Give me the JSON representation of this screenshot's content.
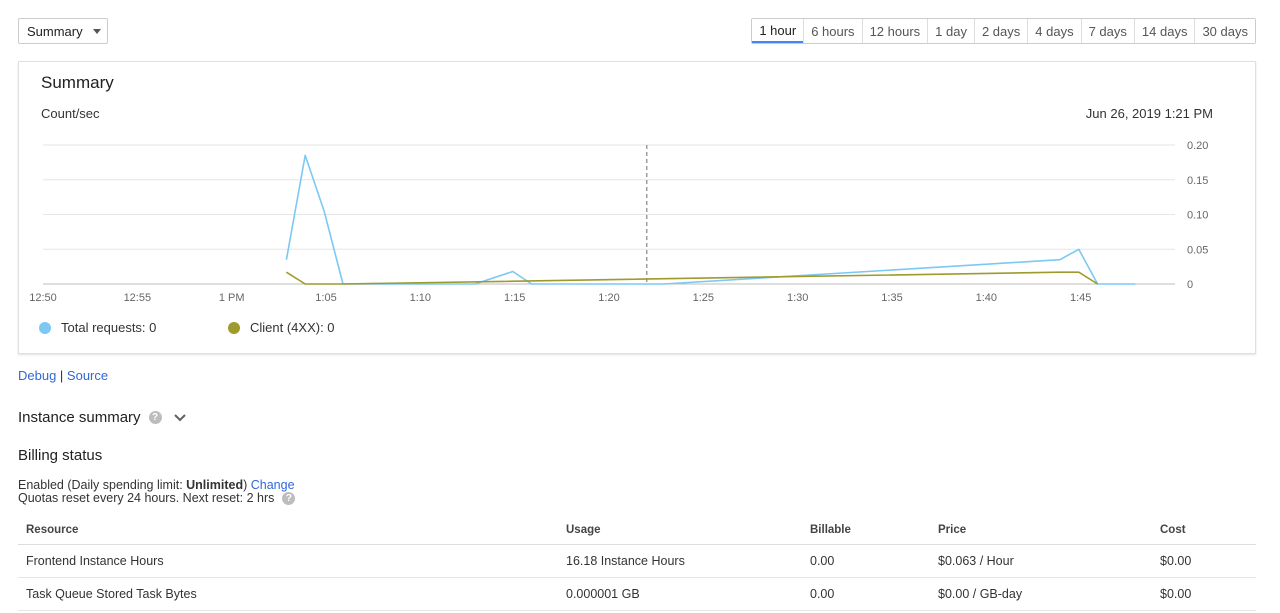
{
  "view_select": {
    "label": "Summary"
  },
  "time_ranges": [
    "1 hour",
    "6 hours",
    "12 hours",
    "1 day",
    "2 days",
    "4 days",
    "7 days",
    "14 days",
    "30 days"
  ],
  "active_range_index": 0,
  "card": {
    "title": "Summary",
    "unit": "Count/sec",
    "timestamp": "Jun 26, 2019 1:21 PM"
  },
  "chart_data": {
    "type": "line",
    "x_tick_labels": [
      "12:50",
      "12:55",
      "1 PM",
      "1:05",
      "1:10",
      "1:15",
      "1:20",
      "1:25",
      "1:30",
      "1:35",
      "1:40",
      "1:45"
    ],
    "y_tick_labels": [
      "0.20",
      "0.15",
      "0.10",
      "0.05",
      "0"
    ],
    "ylim": [
      0,
      0.2
    ],
    "xlim_minutes": [
      0,
      60
    ],
    "grid": true,
    "marker_minute": 32,
    "series": [
      {
        "name": "Total requests",
        "legend": "Total requests: 0",
        "color": "#7cc8f5",
        "x": [
          12.9,
          13.9,
          14.9,
          15.9,
          22.9,
          24.9,
          25.9,
          32.9,
          53.9,
          54.9,
          55.9,
          57.9
        ],
        "y": [
          0.035,
          0.185,
          0.105,
          0,
          0,
          0.018,
          0,
          0,
          0.035,
          0.05,
          0,
          0
        ]
      },
      {
        "name": "Client (4XX)",
        "legend": "Client (4XX): 0",
        "color": "#9e9a2b",
        "x": [
          12.9,
          13.9,
          15.9,
          53.9,
          54.9,
          55.9
        ],
        "y": [
          0.017,
          0,
          0,
          0.017,
          0.017,
          0
        ]
      }
    ]
  },
  "links": {
    "debug": "Debug",
    "separator": " | ",
    "source": "Source"
  },
  "instance_summary": {
    "title": "Instance summary",
    "help": "?"
  },
  "billing": {
    "title": "Billing status",
    "line1_prefix": "Enabled (Daily spending limit: ",
    "line1_bold": "Unlimited",
    "line1_suffix": ") ",
    "change_link": "Change",
    "line2": "Quotas reset every 24 hours. Next reset: 2 hrs",
    "help": "?"
  },
  "table": {
    "headers": [
      "Resource",
      "Usage",
      "Billable",
      "Price",
      "Cost"
    ],
    "rows": [
      [
        "Frontend Instance Hours",
        "16.18 Instance Hours",
        "0.00",
        "$0.063 / Hour",
        "$0.00"
      ],
      [
        "Task Queue Stored Task Bytes",
        "0.000001 GB",
        "0.00",
        "$0.00 / GB-day",
        "$0.00"
      ]
    ]
  }
}
